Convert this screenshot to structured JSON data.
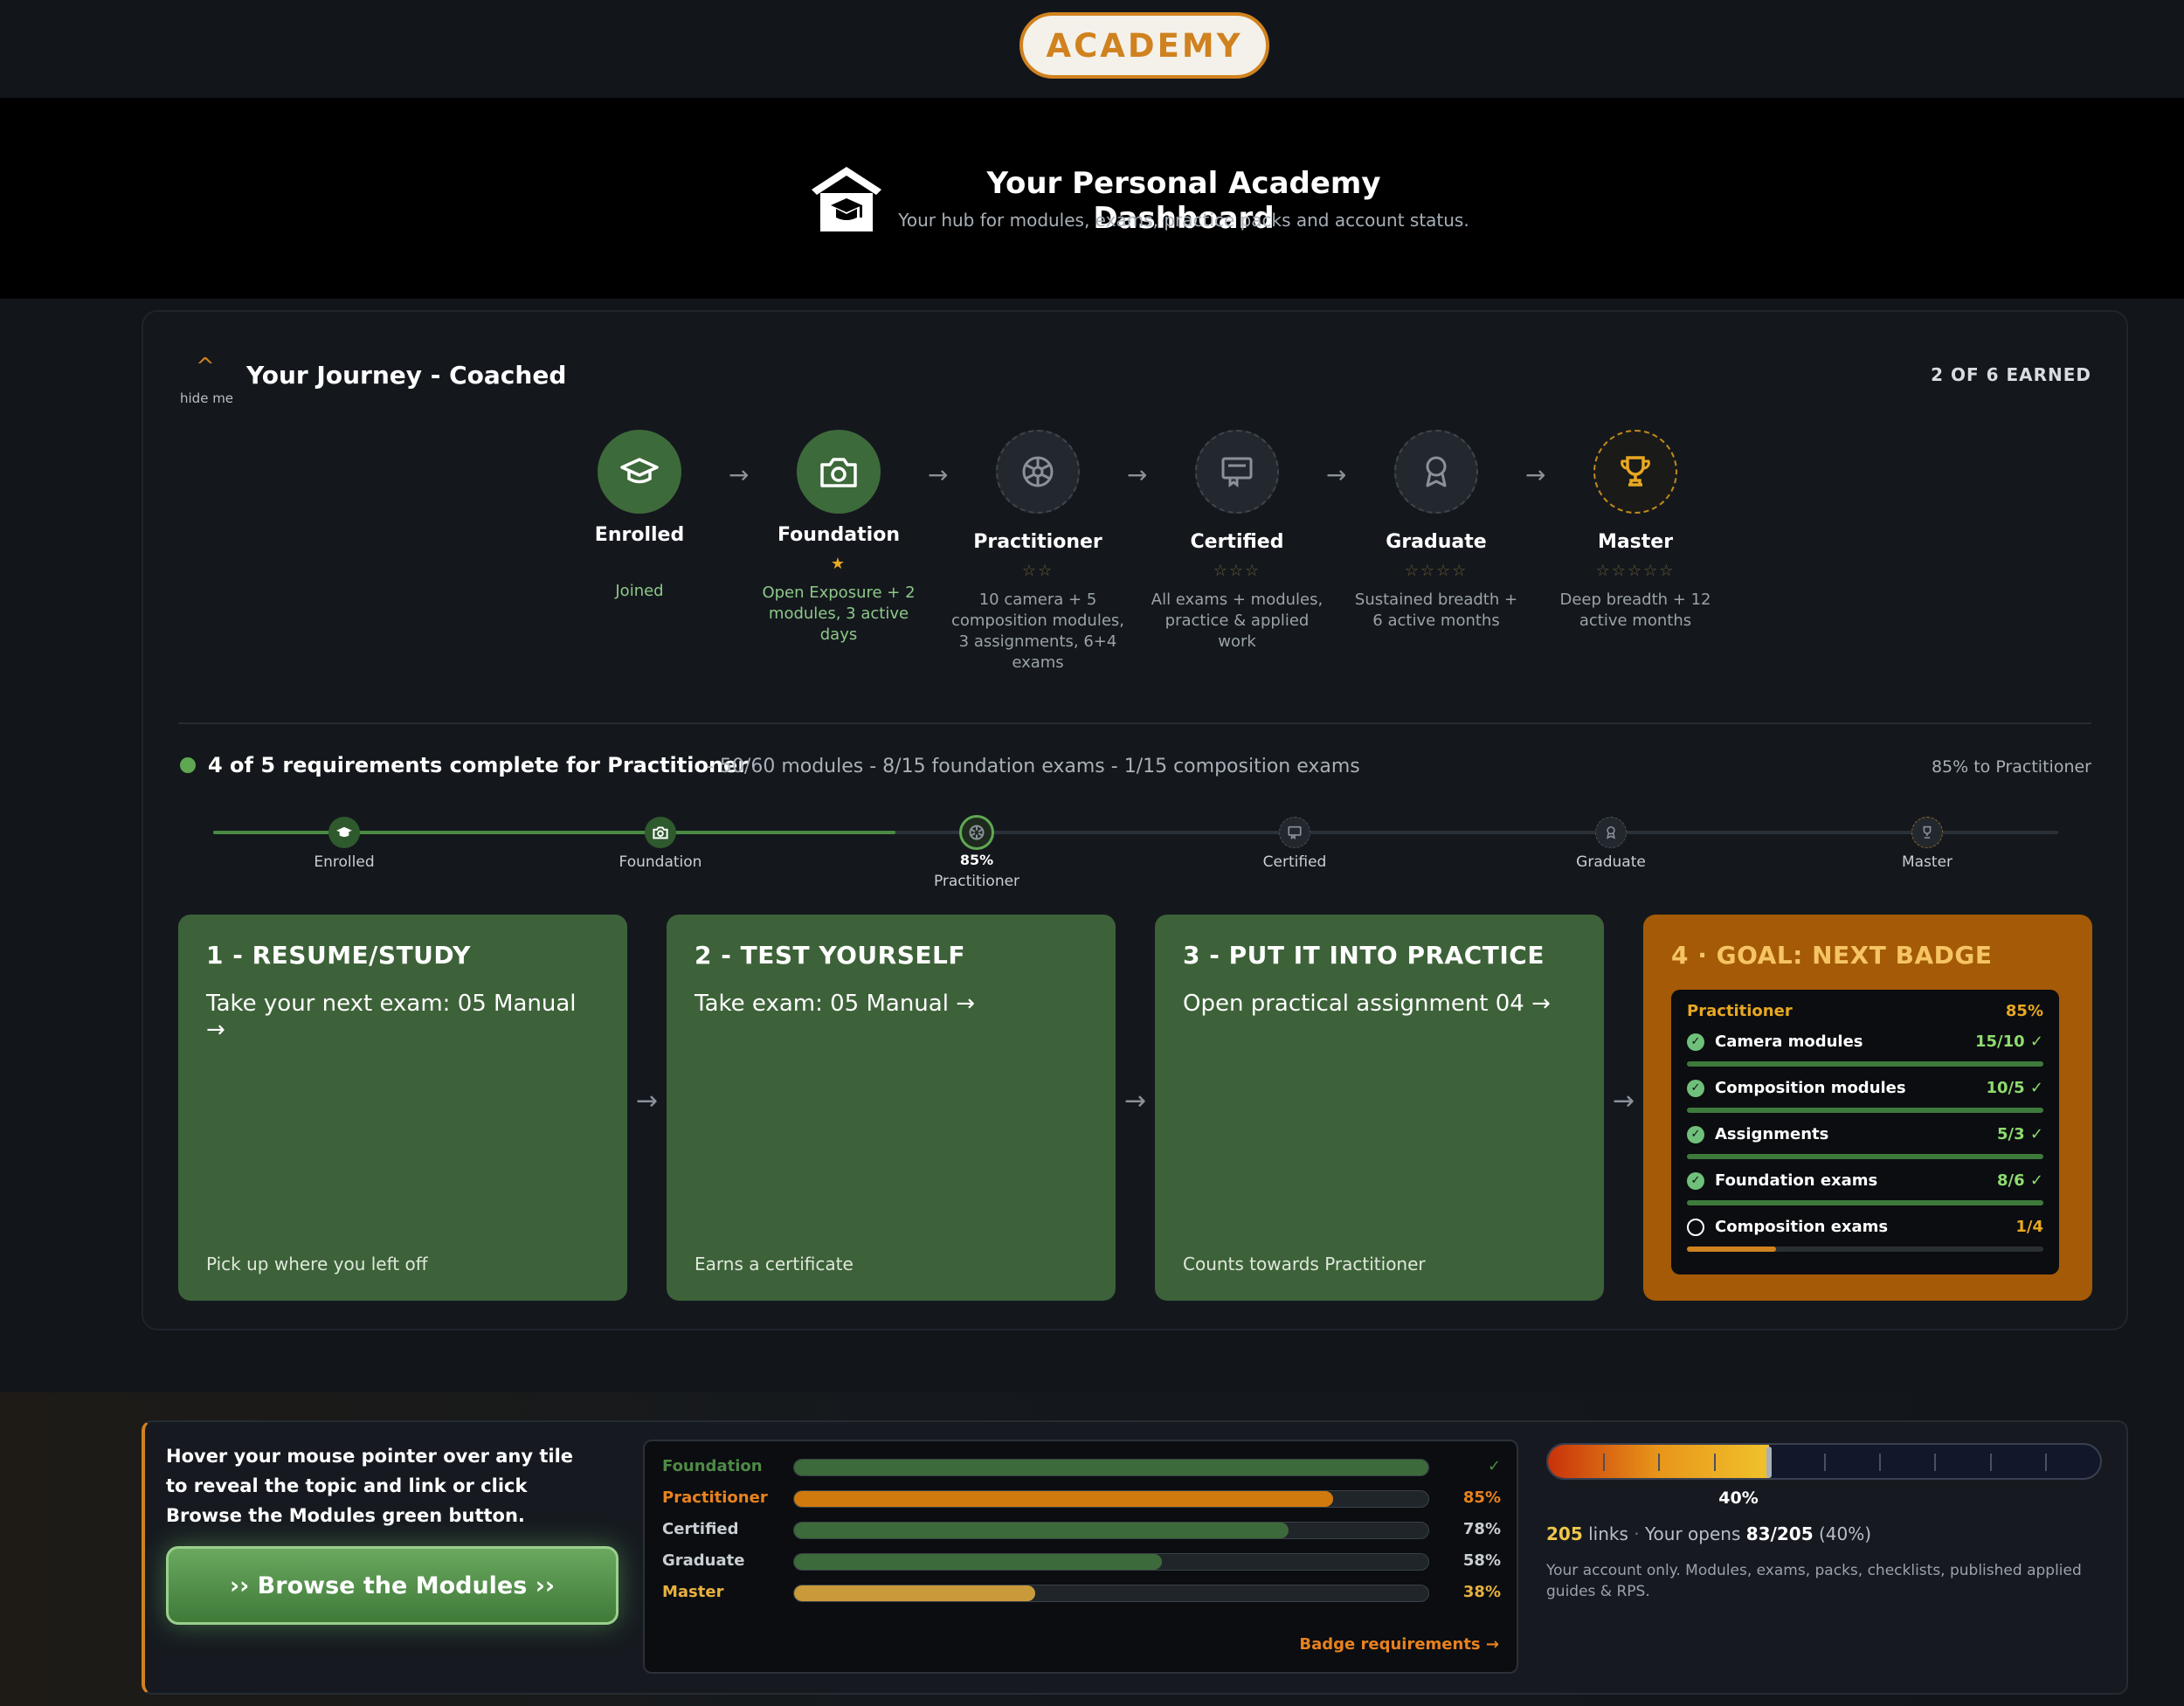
{
  "topbar": {
    "pill": "ACADEMY"
  },
  "hero": {
    "title": "Your Personal Academy Dashboard",
    "subtitle": "Your hub for modules, exams, practice packs and account status."
  },
  "journey": {
    "toggle_label": "hide me",
    "title": "Your Journey - Coached",
    "earned": "2 OF 6 EARNED",
    "steps": [
      {
        "name": "Enrolled",
        "stars": "",
        "desc": "Joined",
        "state": "done",
        "icon": "graduation-cap-icon"
      },
      {
        "name": "Foundation",
        "stars": "★",
        "desc": "Open Exposure + 2 modules, 3 active days",
        "state": "done",
        "icon": "camera-icon"
      },
      {
        "name": "Practitioner",
        "stars": "☆☆",
        "desc": "10 camera + 5 composition modules, 3 assignments, 6+4 exams",
        "state": "todo",
        "icon": "aperture-icon"
      },
      {
        "name": "Certified",
        "stars": "☆☆☆",
        "desc": "All exams + modules, practice & applied work",
        "state": "todo",
        "icon": "certificate-icon"
      },
      {
        "name": "Graduate",
        "stars": "☆☆☆☆",
        "desc": "Sustained breadth + 6 active months",
        "state": "todo",
        "icon": "award-icon"
      },
      {
        "name": "Master",
        "stars": "☆☆☆☆☆",
        "desc": "Deep breadth + 12 active months",
        "state": "gold",
        "icon": "trophy-icon"
      }
    ],
    "requirements": {
      "title": "4 of 5 requirements complete for Practitioner",
      "detail": "- 50/60 modules - 8/15 foundation exams - 1/15 composition exams",
      "pct_text": "85% to Practitioner"
    },
    "progress_nodes": [
      {
        "label": "Enrolled"
      },
      {
        "label": "Foundation"
      },
      {
        "label": "Practitioner",
        "pct": "85%"
      },
      {
        "label": "Certified"
      },
      {
        "label": "Graduate"
      },
      {
        "label": "Master"
      }
    ],
    "progress_fill_fraction": 0.37
  },
  "cards": [
    {
      "title": "1 - RESUME/STUDY",
      "link": "Take your next exam: 05 Manual →",
      "foot": "Pick up where you left off"
    },
    {
      "title": "2 - TEST YOURSELF",
      "link": "Take exam: 05 Manual →",
      "foot": "Earns a certificate"
    },
    {
      "title": "3 - PUT IT INTO PRACTICE",
      "link": "Open practical assignment 04 →",
      "foot": "Counts towards Practitioner"
    }
  ],
  "goal": {
    "title": "4 · GOAL: NEXT BADGE",
    "badge": "Practitioner",
    "pct": "85%",
    "rows": [
      {
        "label": "Camera modules",
        "value": "15/10 ✓",
        "done": true,
        "fill": 1.0
      },
      {
        "label": "Composition modules",
        "value": "10/5 ✓",
        "done": true,
        "fill": 1.0
      },
      {
        "label": "Assignments",
        "value": "5/3 ✓",
        "done": true,
        "fill": 1.0
      },
      {
        "label": "Foundation exams",
        "value": "8/6 ✓",
        "done": true,
        "fill": 1.0
      },
      {
        "label": "Composition exams",
        "value": "1/4",
        "done": false,
        "fill": 0.25
      }
    ]
  },
  "bottom": {
    "hover_text": "Hover your mouse pointer over any tile to reveal the topic and link or click Browse the Modules green button.",
    "browse_label": "›› Browse the Modules ››",
    "bars": [
      {
        "label": "Foundation",
        "value": "✓",
        "fill": 1.0,
        "color": "#3d6a3a",
        "label_color": "#4f8a47"
      },
      {
        "label": "Practitioner",
        "value": "85%",
        "fill": 0.85,
        "color": "#d07a0e",
        "label_color": "#e8821f"
      },
      {
        "label": "Certified",
        "value": "78%",
        "fill": 0.78,
        "color": "#3d6a3a",
        "label_color": "#c8ced4"
      },
      {
        "label": "Graduate",
        "value": "58%",
        "fill": 0.58,
        "color": "#3d6a3a",
        "label_color": "#c8ced4"
      },
      {
        "label": "Master",
        "value": "38%",
        "fill": 0.38,
        "color": "#c99a3a",
        "label_color": "#e8b040"
      }
    ],
    "badge_req": "Badge requirements →",
    "links": {
      "fill": 0.4,
      "pct": "40%",
      "count": "205",
      "count_suffix": "links",
      "opens_label": "Your opens",
      "opens_value": "83/205",
      "opens_pct": "(40%)",
      "note": "Your account only. Modules, exams, packs, checklists, published applied guides & RPS."
    }
  }
}
